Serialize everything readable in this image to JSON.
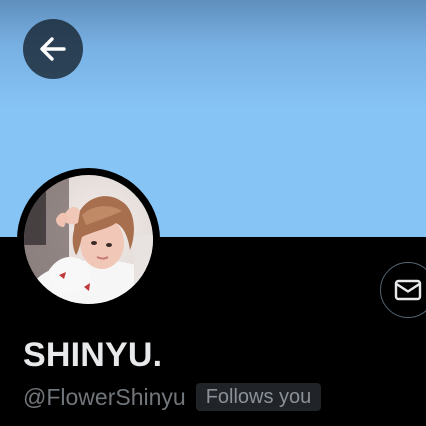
{
  "profile": {
    "display_name": "SHINYU.",
    "handle": "@FlowerShinyu",
    "follows_you_label": "Follows you"
  },
  "icons": {
    "back": "arrow-left-icon",
    "message": "envelope-icon"
  },
  "colors": {
    "banner": "#87c4f6",
    "background": "#000000",
    "name_text": "#e7e9ea",
    "secondary_text": "#71767b",
    "badge_background": "#202327",
    "button_border": "#536471"
  }
}
